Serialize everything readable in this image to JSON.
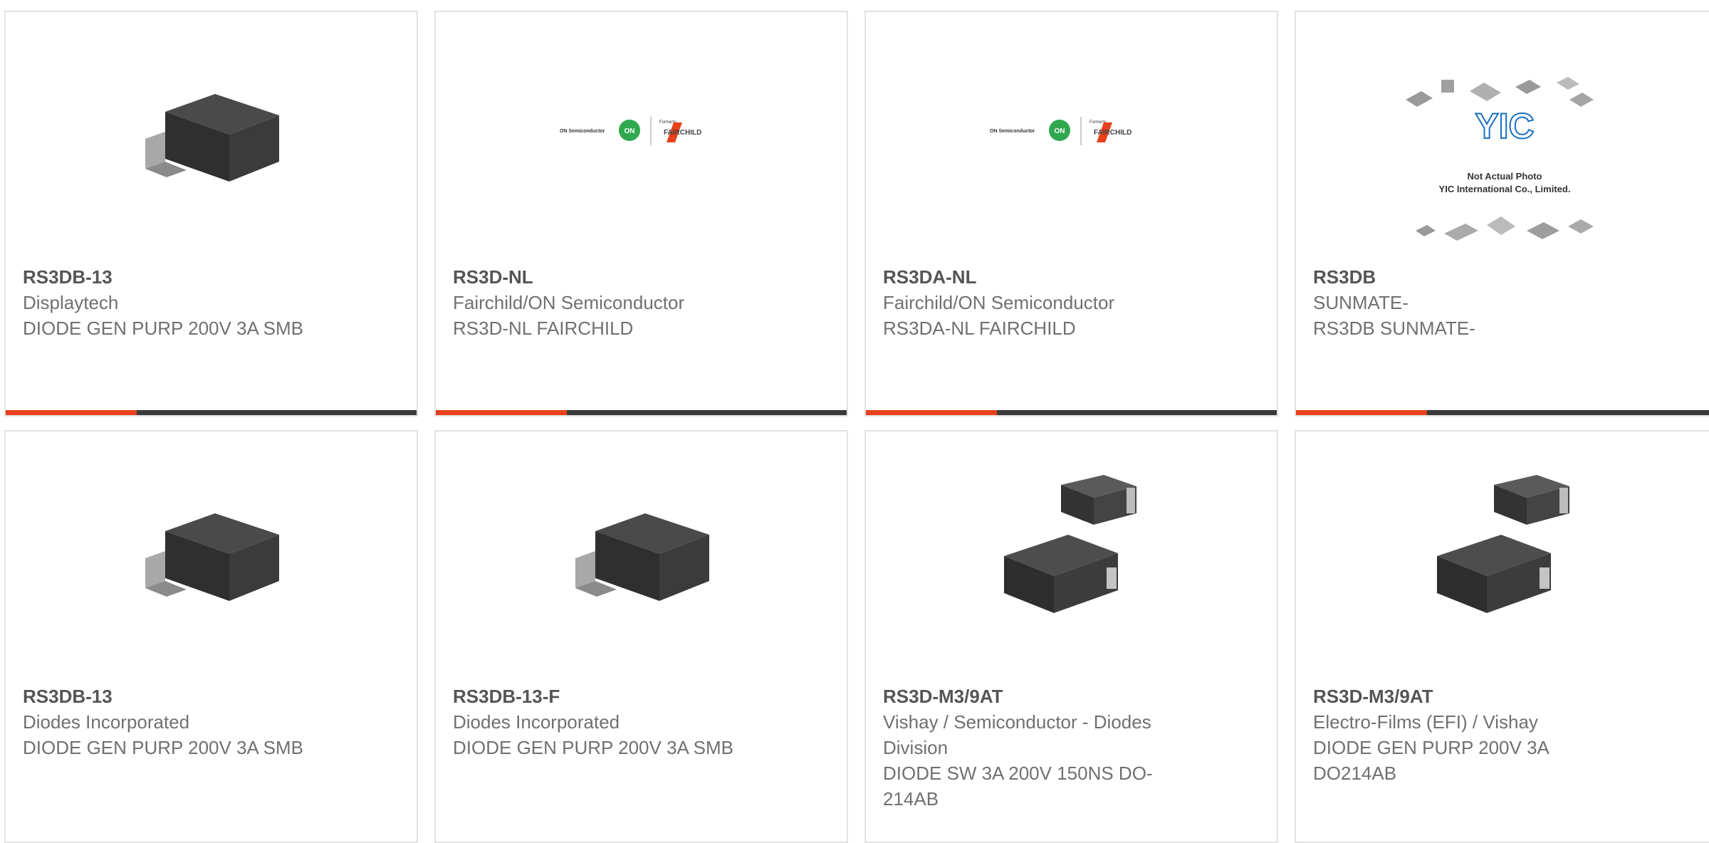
{
  "accent_color": "#e8411a",
  "products": [
    {
      "part": "RS3DB-13",
      "manufacturer": "Displaytech",
      "description": "DIODE GEN PURP 200V 3A SMB",
      "image": "smb-diode-package"
    },
    {
      "part": "RS3D-NL",
      "manufacturer": "Fairchild/ON Semiconductor",
      "description": "RS3D-NL FAIRCHILD",
      "image": "on-fairchild-logo",
      "logo": {
        "left": "ON Semiconductor",
        "badge": "ON",
        "formerly": "Formerly",
        "right": "FAIRCHILD"
      }
    },
    {
      "part": "RS3DA-NL",
      "manufacturer": "Fairchild/ON Semiconductor",
      "description": "RS3DA-NL FAIRCHILD",
      "image": "on-fairchild-logo",
      "logo": {
        "left": "ON Semiconductor",
        "badge": "ON",
        "formerly": "Formerly",
        "right": "FAIRCHILD"
      }
    },
    {
      "part": "RS3DB",
      "manufacturer": "SUNMATE-",
      "description": "RS3DB SUNMATE-",
      "image": "yic-placeholder",
      "placeholder": {
        "brand": "YIC",
        "line1": "Not Actual Photo",
        "line2": "YIC International Co., Limited."
      }
    },
    {
      "part": "RS3DB-13",
      "manufacturer": "Diodes Incorporated",
      "description": "DIODE GEN PURP 200V 3A SMB",
      "image": "smb-diode-package"
    },
    {
      "part": "RS3DB-13-F",
      "manufacturer": "Diodes Incorporated",
      "description": "DIODE GEN PURP 200V 3A SMB",
      "image": "smb-diode-package"
    },
    {
      "part": "RS3D-M3/9AT",
      "manufacturer": "Vishay / Semiconductor - Diodes Division",
      "description": "DIODE SW 3A 200V 150NS DO-214AB",
      "image": "smc-diode-pair"
    },
    {
      "part": "RS3D-M3/9AT",
      "manufacturer": "Electro-Films (EFI) / Vishay",
      "description": "DIODE GEN PURP 200V 3A DO214AB",
      "image": "smc-diode-pair"
    }
  ]
}
